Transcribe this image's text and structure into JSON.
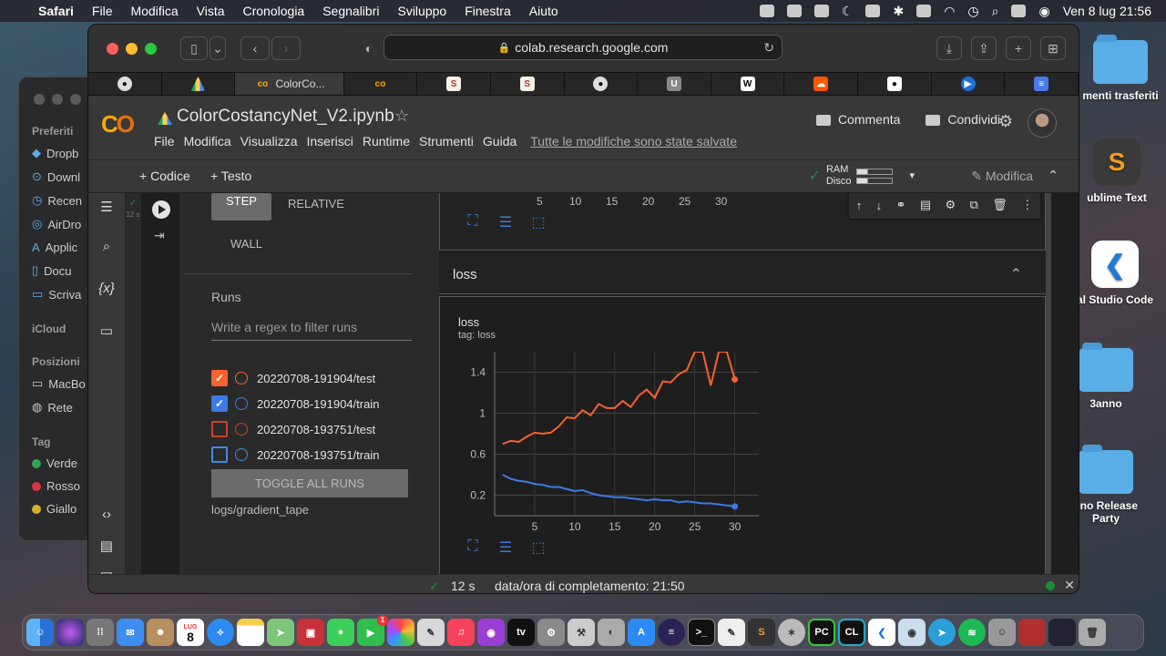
{
  "menubar": {
    "app": "Safari",
    "items": [
      "File",
      "Modifica",
      "Vista",
      "Cronologia",
      "Segnalibri",
      "Sviluppo",
      "Finestra",
      "Aiuto"
    ],
    "clock": "Ven 8 lug  21:56"
  },
  "desktop": {
    "items": [
      {
        "label": "menti trasferiti"
      },
      {
        "label": "ublime Text"
      },
      {
        "label": "al Studio Code"
      },
      {
        "label": "3anno"
      },
      {
        "label": "eno Release Party"
      }
    ]
  },
  "finder": {
    "sections": {
      "fav": "Preferiti",
      "icloud": "iCloud",
      "pos": "Posizioni",
      "tag": "Tag"
    },
    "fav_items": [
      "Dropb",
      "Downl",
      "Recen",
      "AirDro",
      "Applic",
      "Docu",
      "Scriva"
    ],
    "pos_items": [
      "MacBo",
      "Rete"
    ],
    "tags": [
      {
        "label": "Verde",
        "color": "#2ea44f"
      },
      {
        "label": "Rosso",
        "color": "#d9363e"
      },
      {
        "label": "Giallo",
        "color": "#d6b02c"
      }
    ]
  },
  "browser": {
    "url": "colab.research.google.com",
    "active_tab": "ColorCo..."
  },
  "colab": {
    "title": "ColorCostancyNet_V2.ipynb",
    "menus": [
      "File",
      "Modifica",
      "Visualizza",
      "Inserisci",
      "Runtime",
      "Strumenti",
      "Guida"
    ],
    "saved": "Tutte le modifiche sono state salvate",
    "comment": "Commenta",
    "share": "Condividi",
    "add_code": "+ Codice",
    "add_text": "+ Testo",
    "ram": "RAM",
    "disk": "Disco",
    "edit": "Modifica"
  },
  "cell": {
    "exec_time": "12 s"
  },
  "tensorboard": {
    "step": "STEP",
    "relative": "RELATIVE",
    "wall": "WALL",
    "runs_title": "Runs",
    "regex_placeholder": "Write a regex to filter runs",
    "runs": [
      {
        "name": "20220708-191904/test",
        "checked": true,
        "color": "#f7622f"
      },
      {
        "name": "20220708-191904/train",
        "checked": true,
        "color": "#3d7ae5"
      },
      {
        "name": "20220708-193751/test",
        "checked": false,
        "color": "#f7622f"
      },
      {
        "name": "20220708-193751/train",
        "checked": false,
        "color": "#3d8be5"
      }
    ],
    "toggle_all": "TOGGLE ALL RUNS",
    "logdir": "logs/gradient_tape",
    "top_ticks": [
      "5",
      "10",
      "15",
      "20",
      "25",
      "30"
    ],
    "section": "loss"
  },
  "chart_data": {
    "type": "line",
    "title": "loss",
    "subtitle": "tag: loss",
    "xlabel": "",
    "ylabel": "",
    "xlim": [
      0,
      33
    ],
    "ylim": [
      0,
      1.6
    ],
    "xticks": [
      5,
      10,
      15,
      20,
      25,
      30
    ],
    "yticks": [
      0.2,
      0.6,
      1,
      1.4
    ],
    "series": [
      {
        "color": "#f7622f",
        "x": [
          1,
          2,
          3,
          4,
          5,
          6,
          7,
          8,
          9,
          10,
          11,
          12,
          13,
          14,
          15,
          16,
          17,
          18,
          19,
          20,
          21,
          22,
          23,
          24,
          25,
          26,
          27,
          28,
          29,
          30
        ],
        "y": [
          0.7,
          0.73,
          0.72,
          0.77,
          0.81,
          0.8,
          0.81,
          0.87,
          0.96,
          0.95,
          1.03,
          0.98,
          1.09,
          1.05,
          1.05,
          1.12,
          1.06,
          1.17,
          1.23,
          1.15,
          1.31,
          1.3,
          1.38,
          1.42,
          1.6,
          1.6,
          1.27,
          1.6,
          1.6,
          1.33
        ]
      },
      {
        "color": "#3d7ae5",
        "x": [
          1,
          2,
          3,
          4,
          5,
          6,
          7,
          8,
          9,
          10,
          11,
          12,
          13,
          14,
          15,
          16,
          17,
          18,
          19,
          20,
          21,
          22,
          23,
          24,
          25,
          26,
          27,
          28,
          29,
          30
        ],
        "y": [
          0.4,
          0.36,
          0.34,
          0.33,
          0.31,
          0.3,
          0.28,
          0.28,
          0.26,
          0.24,
          0.25,
          0.22,
          0.2,
          0.19,
          0.18,
          0.18,
          0.17,
          0.16,
          0.15,
          0.16,
          0.15,
          0.15,
          0.13,
          0.14,
          0.13,
          0.12,
          0.12,
          0.11,
          0.1,
          0.09
        ]
      }
    ]
  },
  "status": {
    "secs": "12 s",
    "done": "data/ora di completamento: 21:50"
  },
  "dock": {
    "calendar_month": "LUG",
    "calendar_day": "8",
    "facetime_badge": "1"
  }
}
